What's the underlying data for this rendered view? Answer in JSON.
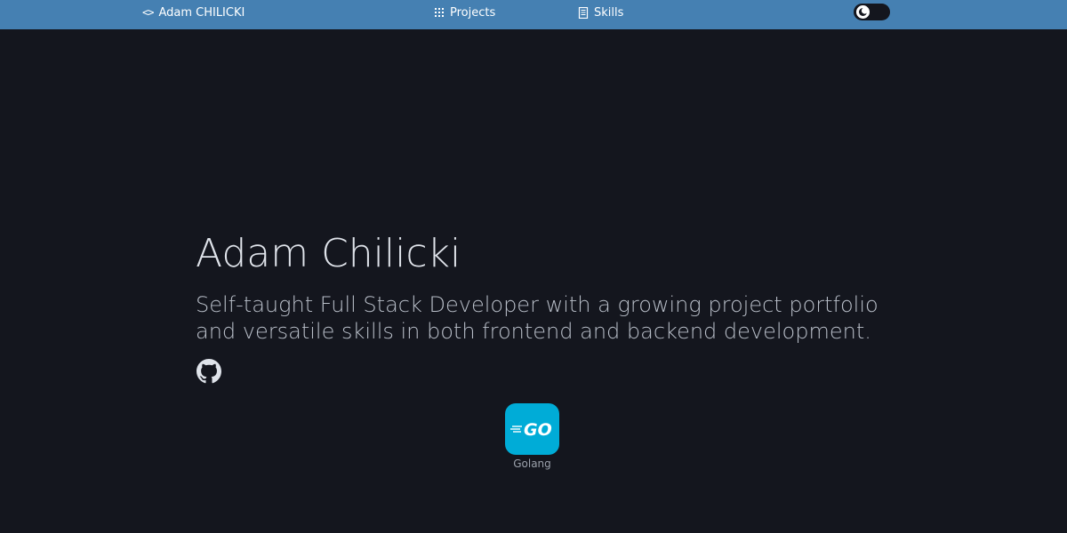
{
  "navbar": {
    "brand_glyph": "<>",
    "brand_label": "Adam  CHILICKI",
    "projects_label": "Projects",
    "skills_label": "Skills",
    "theme_toggle_icon": "moon-icon"
  },
  "hero": {
    "name": "Adam Chilicki",
    "tagline": "Self-taught Full Stack Developer with a growing project portfolio and versatile skills in both frontend and backend development.",
    "github_icon": "github-icon"
  },
  "skills": [
    {
      "label": "Golang",
      "logo_text": "GO",
      "logo_color": "#00acd7"
    }
  ],
  "colors": {
    "navbar": "#4580b2",
    "background": "#14161e",
    "heading": "#dfe3ea",
    "tagline": "#b9bfc9"
  }
}
